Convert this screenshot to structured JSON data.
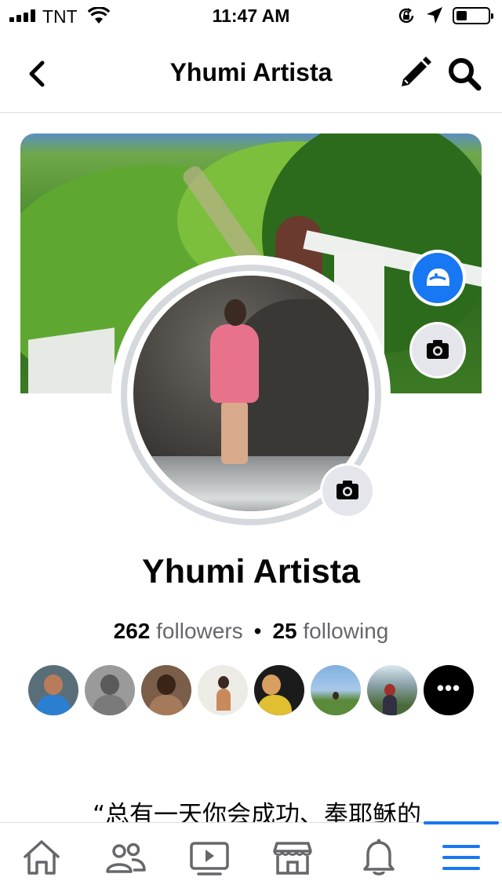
{
  "status_bar": {
    "carrier": "TNT",
    "time": "11:47 AM",
    "signal_bars": 4,
    "battery_level": 0.35
  },
  "header": {
    "title": "Yhumi Artista",
    "back_icon": "chevron-left-icon",
    "edit_icon": "pencil-icon",
    "search_icon": "search-icon"
  },
  "profile": {
    "name": "Yhumi Artista",
    "followers_count": "262",
    "followers_label": "followers",
    "separator": "•",
    "following_count": "25",
    "following_label": "following",
    "friends": [
      {
        "name": "friend-1"
      },
      {
        "name": "friend-2"
      },
      {
        "name": "friend-3"
      },
      {
        "name": "friend-4"
      },
      {
        "name": "friend-5"
      },
      {
        "name": "friend-6"
      },
      {
        "name": "friend-7"
      }
    ],
    "more_friends_label": "•••"
  },
  "bio": {
    "quote": "“总有一天你会成功、奉耶稣的"
  },
  "tab_bar": {
    "tabs": [
      "home-icon",
      "friends-icon",
      "watch-icon",
      "marketplace-icon",
      "notifications-icon",
      "menu-icon"
    ],
    "active_tab": "menu-icon"
  },
  "colors": {
    "accent": "#1877f2",
    "text": "#050505",
    "secondary_text": "#65676b",
    "divider": "#dadde1",
    "button_bg": "#e4e6eb"
  }
}
